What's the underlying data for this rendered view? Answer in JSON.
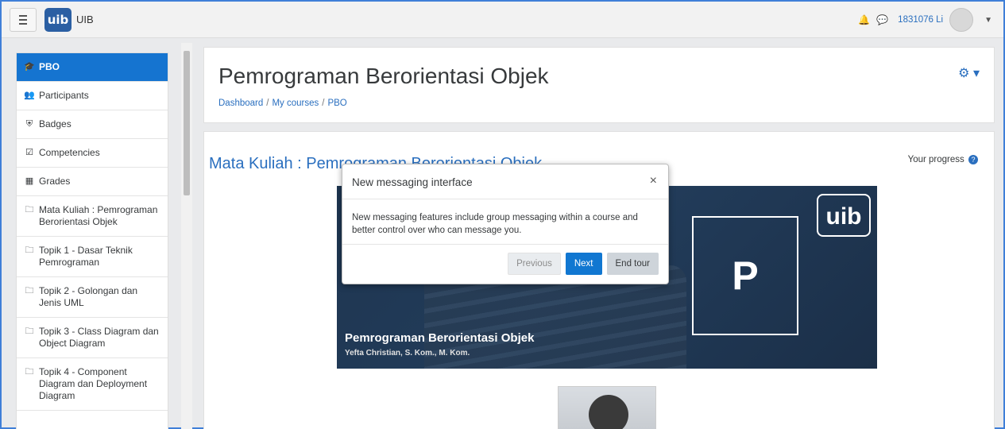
{
  "navbar": {
    "site_name": "UIB",
    "logo_text": "uib",
    "user_name": "1831076 Li"
  },
  "sidebar": {
    "items": [
      {
        "label": "PBO",
        "icon": "graduation-cap-icon",
        "glyph": "🎓"
      },
      {
        "label": "Participants",
        "icon": "users-icon",
        "glyph": "👥"
      },
      {
        "label": "Badges",
        "icon": "shield-icon",
        "glyph": "⛨"
      },
      {
        "label": "Competencies",
        "icon": "check-square-icon",
        "glyph": "☑"
      },
      {
        "label": "Grades",
        "icon": "table-icon",
        "glyph": "▦"
      },
      {
        "label": "Mata Kuliah : Pemrograman Berorientasi Objek",
        "icon": "folder-icon",
        "glyph": "🗀"
      },
      {
        "label": "Topik 1 - Dasar Teknik Pemrograman",
        "icon": "folder-icon",
        "glyph": "🗀"
      },
      {
        "label": "Topik 2 - Golongan dan Jenis UML",
        "icon": "folder-icon",
        "glyph": "🗀"
      },
      {
        "label": "Topik 3 - Class Diagram dan Object Diagram",
        "icon": "folder-icon",
        "glyph": "🗀"
      },
      {
        "label": "Topik 4 - Component Diagram dan Deployment Diagram",
        "icon": "folder-icon",
        "glyph": "🗀"
      }
    ]
  },
  "header": {
    "title": "Pemrograman Berorientasi Objek",
    "breadcrumb": [
      "Dashboard",
      "My courses",
      "PBO"
    ]
  },
  "main": {
    "section_title": "Mata Kuliah : Pemrograman Berorientasi Objek",
    "progress_label": "Your progress",
    "banner": {
      "logo_text": "uib",
      "letter": "P",
      "title": "Pemrograman Berorientasi Objek",
      "subtitle": "Yefta Christian, S. Kom., M. Kom."
    }
  },
  "modal": {
    "title": "New messaging interface",
    "body": "New messaging features include group messaging within a course and better control over who can message you.",
    "close_glyph": "×",
    "buttons": {
      "previous": "Previous",
      "next": "Next",
      "end": "End tour"
    }
  },
  "colors": {
    "accent": "#1177d1",
    "sidebar_active": "#1574d0",
    "link": "#2a6fbf"
  }
}
